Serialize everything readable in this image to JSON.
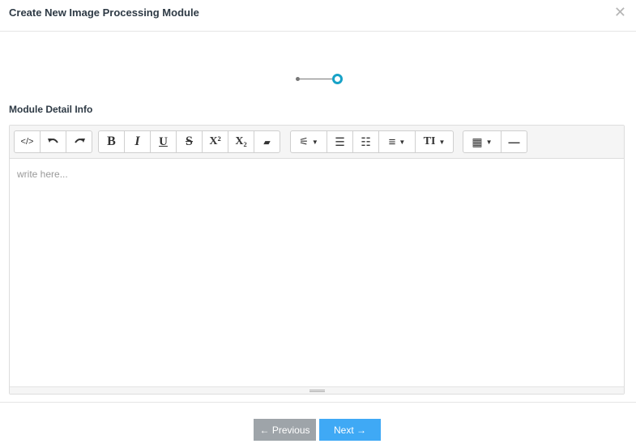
{
  "modal": {
    "title": "Create New Image Processing Module",
    "close_glyph": "✕"
  },
  "section": {
    "label": "Module Detail Info"
  },
  "toolbar": {
    "code_view": "</>",
    "undo": "↶",
    "redo": "↷",
    "bold": "B",
    "italic": "I",
    "underline": "U",
    "strikethrough": "S",
    "superscript": "X²",
    "subscript": "X₂",
    "eraser": "▰",
    "magic": "⚟",
    "caret": "▼",
    "unordered_list": "☰",
    "ordered_list": "☷",
    "align": "≡",
    "font_size": "TI",
    "table": "▦",
    "hr": "—"
  },
  "editor": {
    "placeholder": "write here..."
  },
  "footer": {
    "previous_label": "← Previous",
    "next_label": "Next →"
  },
  "colors": {
    "accent": "#3fa9f5",
    "step_active": "#17a2c7",
    "previous_bg": "#9ea4a9"
  }
}
